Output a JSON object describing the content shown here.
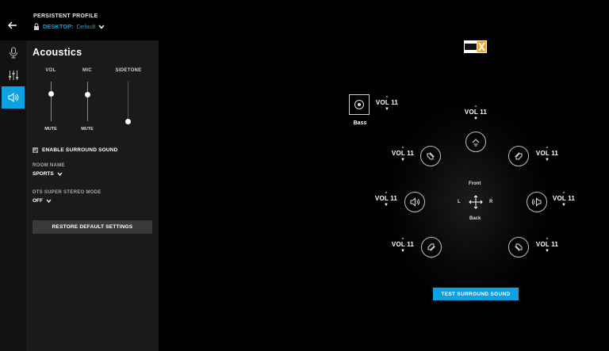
{
  "header": {
    "back_icon": "arrow-left-icon",
    "profile_label": "PERSISTENT PROFILE",
    "profile_name": "DESKTOP:",
    "profile_value": "Default"
  },
  "sidebar": {
    "items": [
      {
        "name": "microphone",
        "icon": "microphone-icon",
        "active": false
      },
      {
        "name": "equalizer",
        "icon": "sliders-icon",
        "active": false
      },
      {
        "name": "acoustics",
        "icon": "speaker-icon",
        "active": true
      }
    ]
  },
  "panel": {
    "title": "Acoustics",
    "sliders": [
      {
        "label": "VOL",
        "bottom_label": "MUTE",
        "level": 0.7
      },
      {
        "label": "MIC",
        "bottom_label": "MUTE",
        "level": 0.68
      },
      {
        "label": "SIDETONE",
        "bottom_label": "",
        "level": 0.0
      }
    ],
    "surround_checkbox_label": "ENABLE SURROUND SOUND",
    "surround_checked": true,
    "room_name_label": "ROOM NAME",
    "room_name_value": "SPORTS",
    "dts_mode_label": "DTS SUPER STEREO MODE",
    "dts_mode_value": "OFF",
    "restore_button": "RESTORE DEFAULT SETTINGS"
  },
  "surround": {
    "bass_label": "Bass",
    "bass_vol": "VOL 11",
    "front_center_vol": "VOL 11",
    "front_left_vol": "VOL 11",
    "front_right_vol": "VOL 11",
    "side_left_vol": "VOL 11",
    "side_right_vol": "VOL 11",
    "rear_left_vol": "VOL 11",
    "rear_right_vol": "VOL 11",
    "front_label": "Front",
    "back_label": "Back",
    "left_label": "L",
    "right_label": "R",
    "test_button": "TEST SURROUND SOUND"
  },
  "colors": {
    "accent": "#0aa2e3",
    "panel_bg": "#1a1a1a",
    "sidebar_bg": "#111111"
  }
}
